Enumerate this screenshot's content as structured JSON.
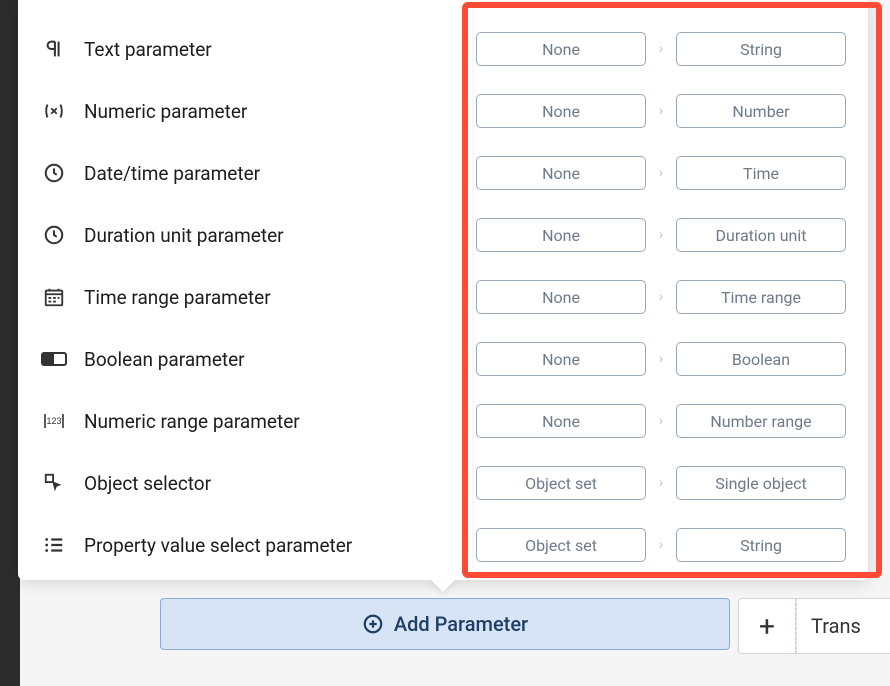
{
  "panel": {
    "rows": [
      {
        "icon": "pilcrow-icon",
        "label": "Text parameter",
        "input": "None",
        "output": "String"
      },
      {
        "icon": "variable-icon",
        "label": "Numeric parameter",
        "input": "None",
        "output": "Number"
      },
      {
        "icon": "clock-icon",
        "label": "Date/time parameter",
        "input": "None",
        "output": "Time"
      },
      {
        "icon": "clock-outline-icon",
        "label": "Duration unit parameter",
        "input": "None",
        "output": "Duration unit"
      },
      {
        "icon": "calendar-icon",
        "label": "Time range parameter",
        "input": "None",
        "output": "Time range"
      },
      {
        "icon": "toggle-icon",
        "label": "Boolean parameter",
        "input": "None",
        "output": "Boolean"
      },
      {
        "icon": "numeric-range-icon",
        "label": "Numeric range parameter",
        "input": "None",
        "output": "Number range"
      },
      {
        "icon": "object-selector-icon",
        "label": "Object selector",
        "input": "Object set",
        "output": "Single object"
      },
      {
        "icon": "list-icon",
        "label": "Property value select parameter",
        "input": "Object set",
        "output": "String"
      }
    ],
    "chevron": "›"
  },
  "actions": {
    "add_parameter": "Add Parameter",
    "plus": "+",
    "trans": "Trans"
  }
}
